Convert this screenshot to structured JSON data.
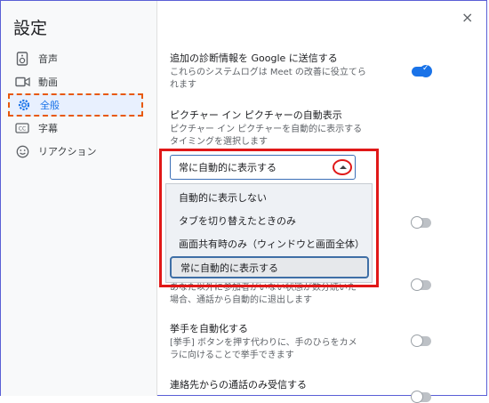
{
  "title": "設定",
  "nav": [
    {
      "label": "音声",
      "icon": "speaker-icon"
    },
    {
      "label": "動画",
      "icon": "video-icon"
    },
    {
      "label": "全般",
      "icon": "gear-icon"
    },
    {
      "label": "字幕",
      "icon": "captions-icon"
    },
    {
      "label": "リアクション",
      "icon": "smiley-icon"
    }
  ],
  "close_glyph": "×",
  "settings": {
    "diagnostics": {
      "title": "追加の診断情報を Google に送信する",
      "desc": [
        "これらのシステムログは Meet の改善に役立てら",
        "れます"
      ],
      "enabled": true
    },
    "pip": {
      "title": "ピクチャー イン ピクチャーの自動表示",
      "desc": [
        "ピクチャー イン ピクチャーを自動的に表示する",
        "タイミングを選択します"
      ],
      "selected": "常に自動的に表示する",
      "options": [
        "自動的に表示しない",
        "タブを切り替えたときのみ",
        "画面共有時のみ（ウィンドウと画面全体）",
        "常に自動的に表示する"
      ]
    },
    "auto_leave": {
      "desc": [
        "あなた以外に参加者がいない状態が数分続いた",
        "場合、通話から自動的に退出します"
      ],
      "enabled": false
    },
    "hand": {
      "title": "挙手を自動化する",
      "desc": [
        "[挙手] ボタンを押す代わりに、手のひらをカメ",
        "ラに向けることで挙手できます"
      ],
      "enabled": false
    },
    "contacts": {
      "title": "連絡先からの通話のみ受信する",
      "enabled": false
    }
  }
}
